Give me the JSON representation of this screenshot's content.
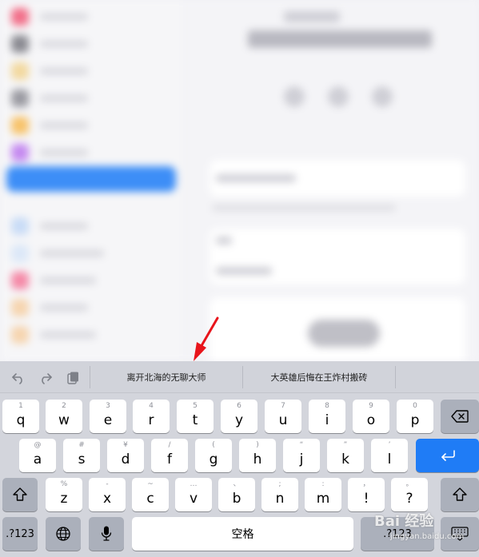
{
  "toolbar": {
    "undo_icon": "undo-arrow-icon",
    "redo_icon": "redo-arrow-icon",
    "paste_icon": "clipboard-icon",
    "suggestions": [
      "离开北海的无聊大师",
      "大英雄后悔在王炸村搬砖"
    ]
  },
  "keyboard": {
    "row1": [
      {
        "main": "q",
        "sub": "1"
      },
      {
        "main": "w",
        "sub": "2"
      },
      {
        "main": "e",
        "sub": "3"
      },
      {
        "main": "r",
        "sub": "4"
      },
      {
        "main": "t",
        "sub": "5"
      },
      {
        "main": "y",
        "sub": "6"
      },
      {
        "main": "u",
        "sub": "7"
      },
      {
        "main": "i",
        "sub": "8"
      },
      {
        "main": "o",
        "sub": "9"
      },
      {
        "main": "p",
        "sub": "0"
      }
    ],
    "row2": [
      {
        "main": "a",
        "sub": "@"
      },
      {
        "main": "s",
        "sub": "#"
      },
      {
        "main": "d",
        "sub": "¥"
      },
      {
        "main": "f",
        "sub": "/"
      },
      {
        "main": "g",
        "sub": "("
      },
      {
        "main": "h",
        "sub": ")"
      },
      {
        "main": "j",
        "sub": "“"
      },
      {
        "main": "k",
        "sub": "”"
      },
      {
        "main": "l",
        "sub": "’"
      }
    ],
    "row3": [
      {
        "main": "z",
        "sub": "%"
      },
      {
        "main": "x",
        "sub": "-"
      },
      {
        "main": "c",
        "sub": "~"
      },
      {
        "main": "v",
        "sub": "…"
      },
      {
        "main": "b",
        "sub": "、"
      },
      {
        "main": "n",
        "sub": ";"
      },
      {
        "main": "m",
        "sub": ":"
      },
      {
        "main": "!",
        "sub": "，"
      },
      {
        "main": "?",
        "sub": "。"
      }
    ],
    "numbers_label": ".?123",
    "space_label": "空格",
    "numbers_label_right": ".?123",
    "delete_icon": "backspace-icon",
    "return_icon": "return-arrow-icon",
    "shift_icon": "shift-arrow-icon",
    "globe_icon": "globe-icon",
    "mic_icon": "microphone-icon",
    "dismiss_icon": "keyboard-dismiss-icon"
  },
  "watermark": {
    "text": "Bai 经验",
    "sub": "jingyan.baidu.com"
  },
  "colors": {
    "accent": "#1f7cf6",
    "arrow": "#e8141b",
    "selection": "#3d8ef7"
  }
}
